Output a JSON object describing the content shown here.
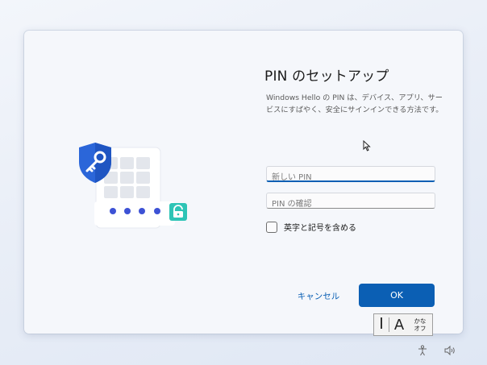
{
  "dialog": {
    "title": "PIN のセットアップ",
    "description": "Windows Hello の PIN は、デバイス、アプリ、サービスにすばやく、安全にサインインできる方法です。",
    "new_pin_placeholder": "新しい PIN",
    "confirm_pin_placeholder": "PIN の確認",
    "include_letters_label": "英字と記号を含める",
    "cancel_label": "キャンセル",
    "ok_label": "OK"
  },
  "ime": {
    "mode_label": "A",
    "kana_line1": "かな",
    "kana_line2": "オフ"
  },
  "icons": {
    "illustration": "pin-shield-key-illustration",
    "tray": [
      "accessibility-icon",
      "volume-icon"
    ]
  },
  "colors": {
    "accent": "#0b5fb4",
    "shield": "#2b66d9",
    "dot": "#3d52d5",
    "lock": "#2ec4b6"
  }
}
